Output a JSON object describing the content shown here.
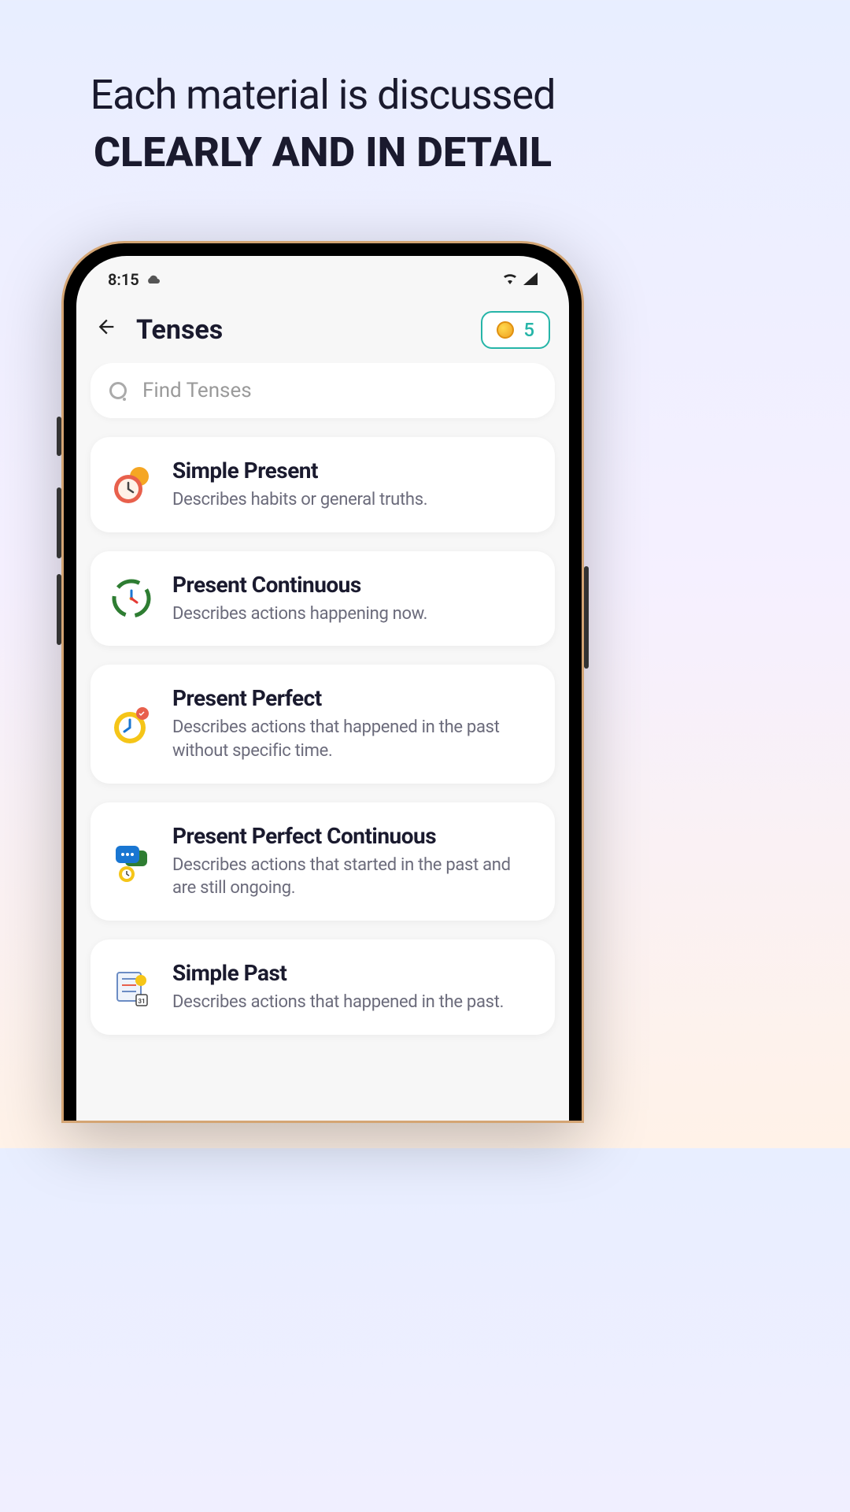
{
  "hero": {
    "line1": "Each material is discussed",
    "line2": "CLEARLY AND IN DETAIL"
  },
  "status": {
    "time": "8:15"
  },
  "header": {
    "title": "Tenses",
    "coin_count": "5"
  },
  "search": {
    "placeholder": "Find Tenses"
  },
  "tenses": [
    {
      "title": "Simple Present",
      "desc": "Describes habits or general truths."
    },
    {
      "title": "Present Continuous",
      "desc": "Describes actions happening now."
    },
    {
      "title": "Present Perfect",
      "desc": "Describes actions that happened in the past without specific time."
    },
    {
      "title": "Present Perfect Continuous",
      "desc": "Describes actions that started in the past and are still ongoing."
    },
    {
      "title": "Simple Past",
      "desc": "Describes actions that happened in the past."
    }
  ]
}
